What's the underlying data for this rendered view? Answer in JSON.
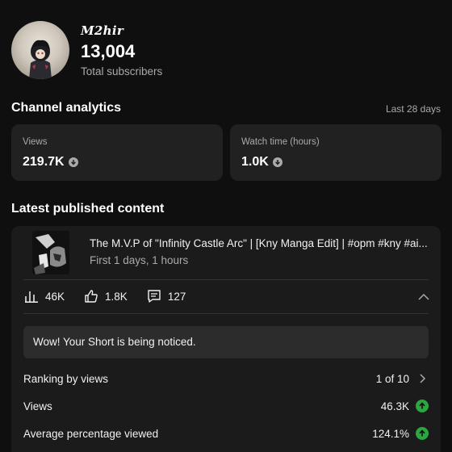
{
  "channel": {
    "name": "M2hir",
    "subscriber_count": "13,004",
    "subscriber_label": "Total subscribers"
  },
  "analytics": {
    "title": "Channel analytics",
    "period": "Last 28 days",
    "views": {
      "label": "Views",
      "value": "219.7K",
      "trend_icon": "arrow-down-circle-icon"
    },
    "watch_time": {
      "label": "Watch time (hours)",
      "value": "1.0K",
      "trend_icon": "arrow-down-circle-icon"
    }
  },
  "latest": {
    "title": "Latest published content",
    "video": {
      "title": "The M.V.P of \"Infinity Castle Arc\" | [Kny Manga Edit] | #opm #kny #ai...",
      "subtitle": "First 1 days, 1 hours"
    },
    "metrics": {
      "views": "46K",
      "likes": "1.8K",
      "comments": "127"
    },
    "notice": "Wow! Your Short is being noticed.",
    "ranking": {
      "label": "Ranking by views",
      "value": "1 of 10"
    },
    "views_row": {
      "label": "Views",
      "value": "46.3K"
    },
    "avg_viewed_row": {
      "label": "Average percentage viewed",
      "value": "124.1%"
    }
  },
  "colors": {
    "background": "#0f0f0f",
    "card": "#212121",
    "positive": "#2ba640",
    "muted_text": "#aaaaaa"
  }
}
